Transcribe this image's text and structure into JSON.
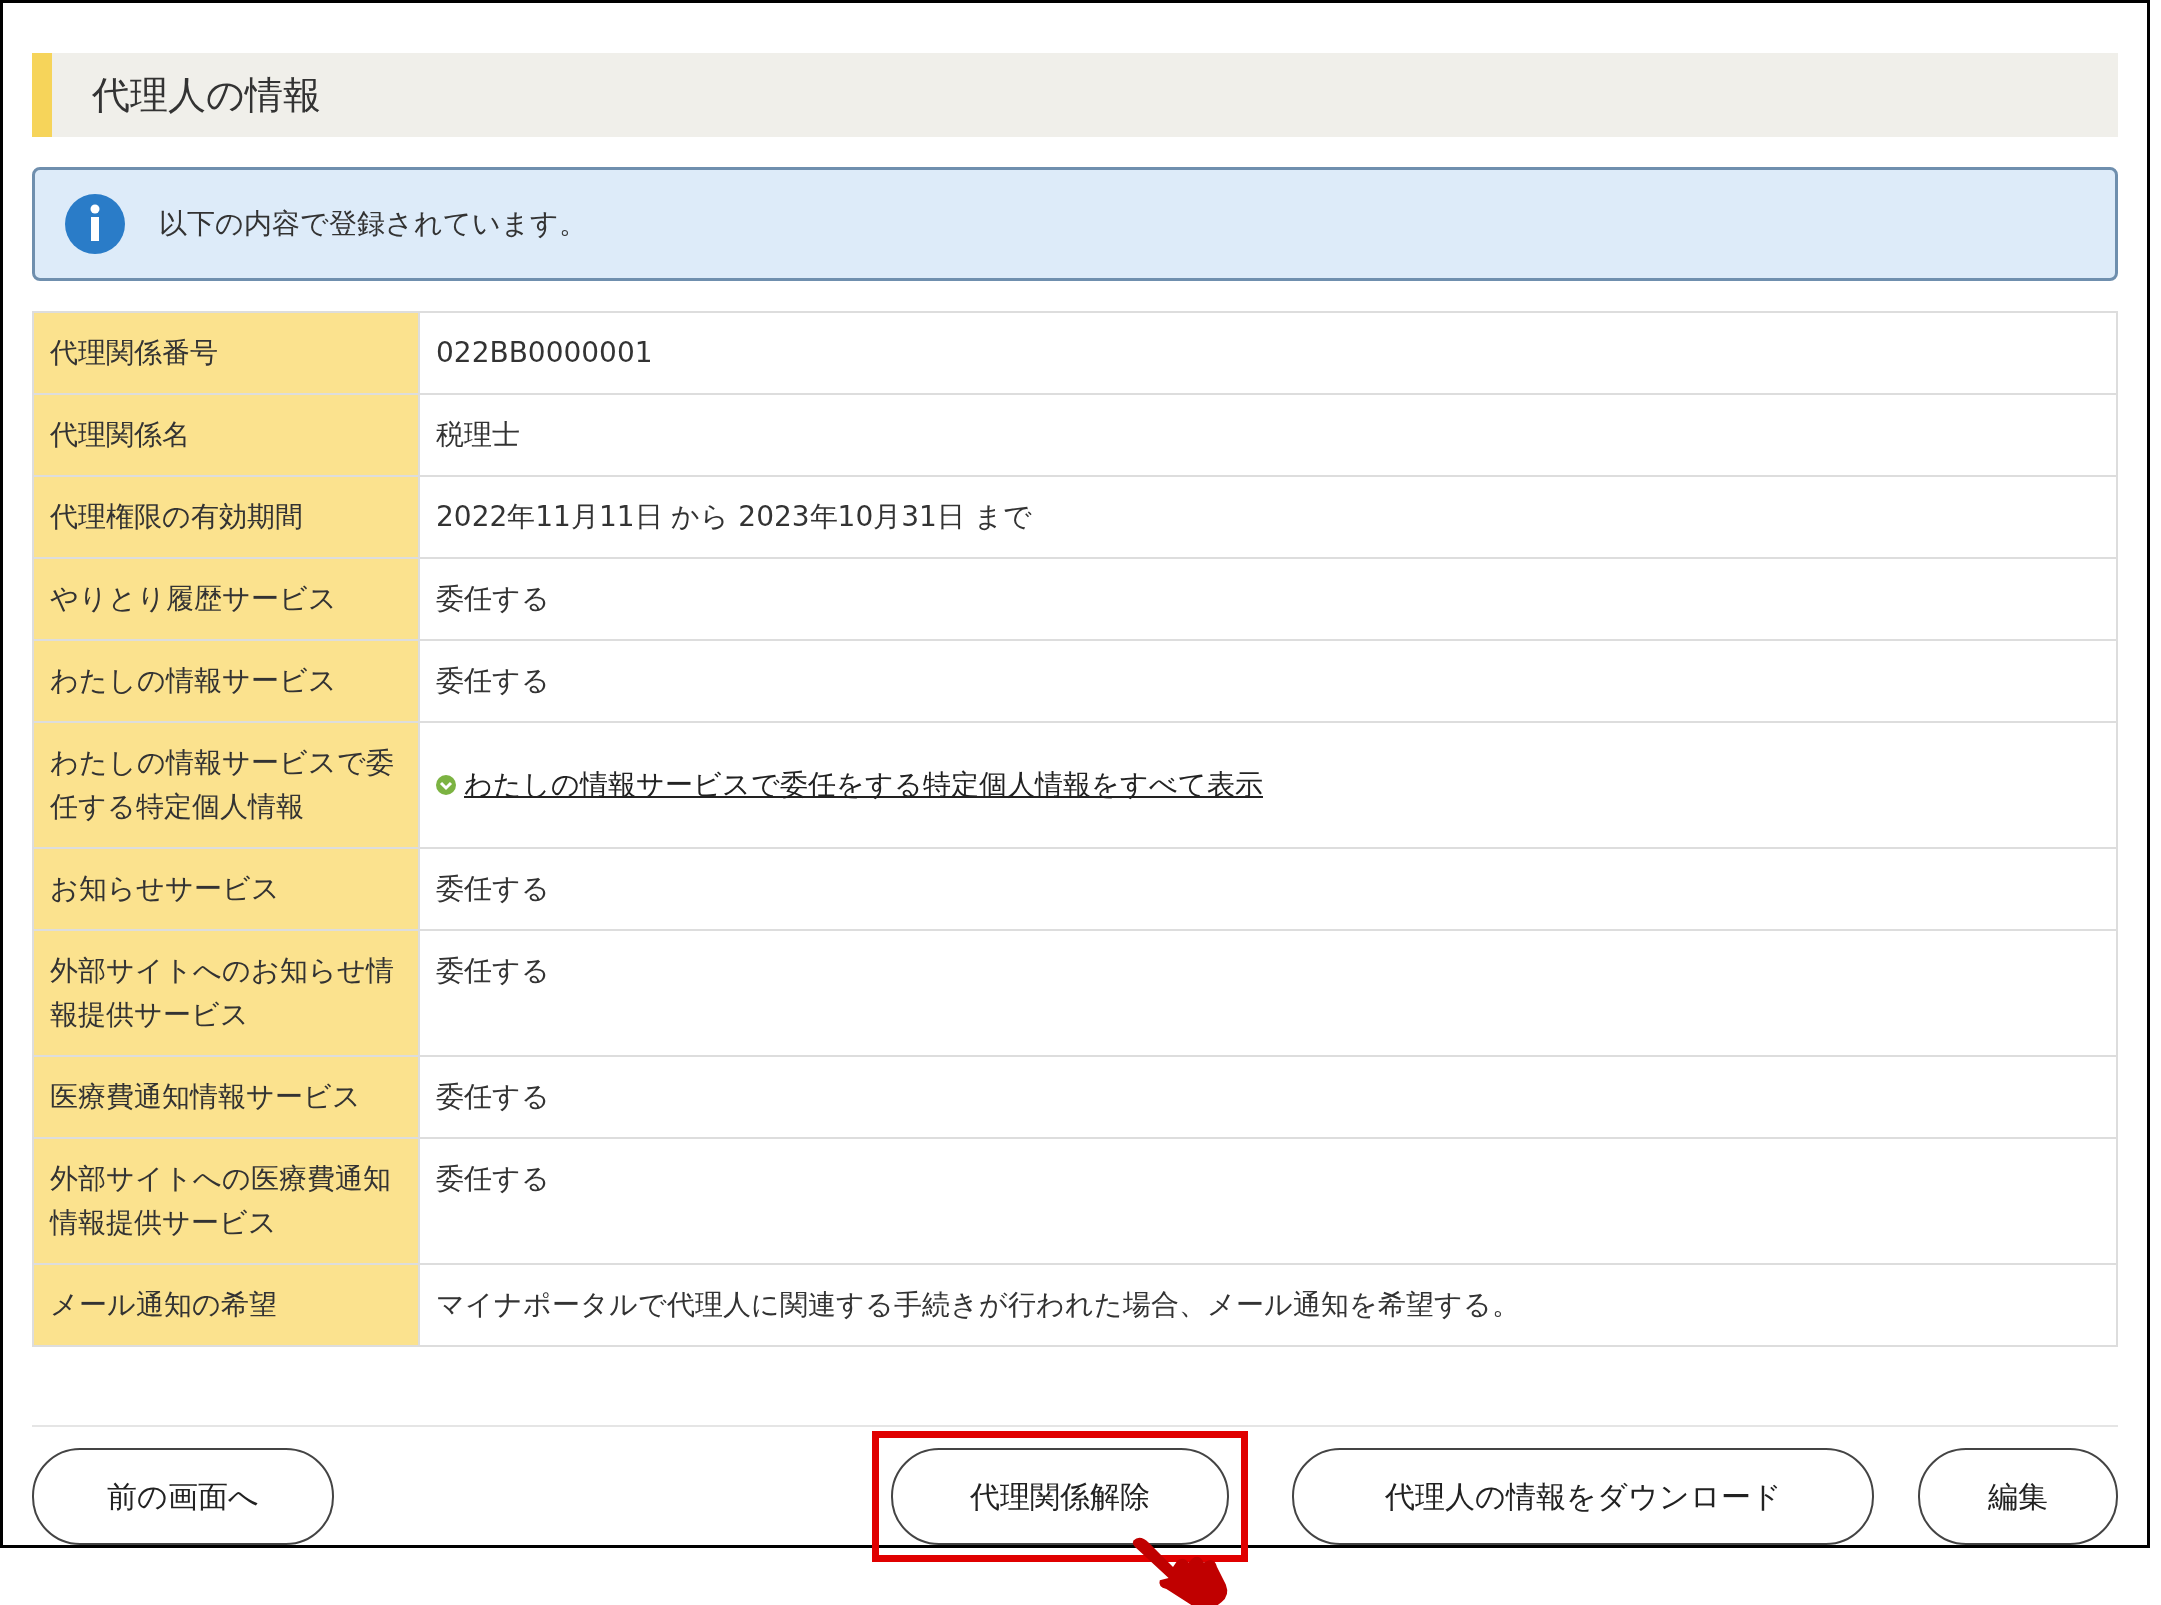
{
  "section_title": "代理人の情報",
  "notice": {
    "kind": "info",
    "text": "以下の内容で登録されています。"
  },
  "rows": [
    {
      "label": "代理関係番号",
      "kind": "text",
      "value": "022BB0000001"
    },
    {
      "label": "代理関係名",
      "kind": "text",
      "value": "税理士"
    },
    {
      "label": "代理権限の有効期間",
      "kind": "text",
      "value": "2022年11月11日 から 2023年10月31日 まで"
    },
    {
      "label": "やりとり履歴サービス",
      "kind": "text",
      "value": "委任する"
    },
    {
      "label": "わたしの情報サービス",
      "kind": "text",
      "value": "委任する"
    },
    {
      "label": "わたしの情報サービスで委任する特定個人情報",
      "kind": "link",
      "value": "わたしの情報サービスで委任をする特定個人情報をすべて表示"
    },
    {
      "label": "お知らせサービス",
      "kind": "text",
      "value": "委任する"
    },
    {
      "label": "外部サイトへのお知らせ情報提供サービス",
      "kind": "text",
      "value": "委任する"
    },
    {
      "label": "医療費通知情報サービス",
      "kind": "text",
      "value": "委任する"
    },
    {
      "label": "外部サイトへの医療費通知情報提供サービス",
      "kind": "text",
      "value": "委任する"
    },
    {
      "label": "メール通知の希望",
      "kind": "text",
      "value": "マイナポータルで代理人に関連する手続きが行われた場合、メール通知を希望する。"
    }
  ],
  "buttons": [
    {
      "label": "前の画面へ",
      "highlighted": false
    },
    {
      "label": "代理関係解除",
      "highlighted": true
    },
    {
      "label": "代理人の情報をダウンロード",
      "highlighted": false
    },
    {
      "label": "編集",
      "highlighted": false
    }
  ]
}
